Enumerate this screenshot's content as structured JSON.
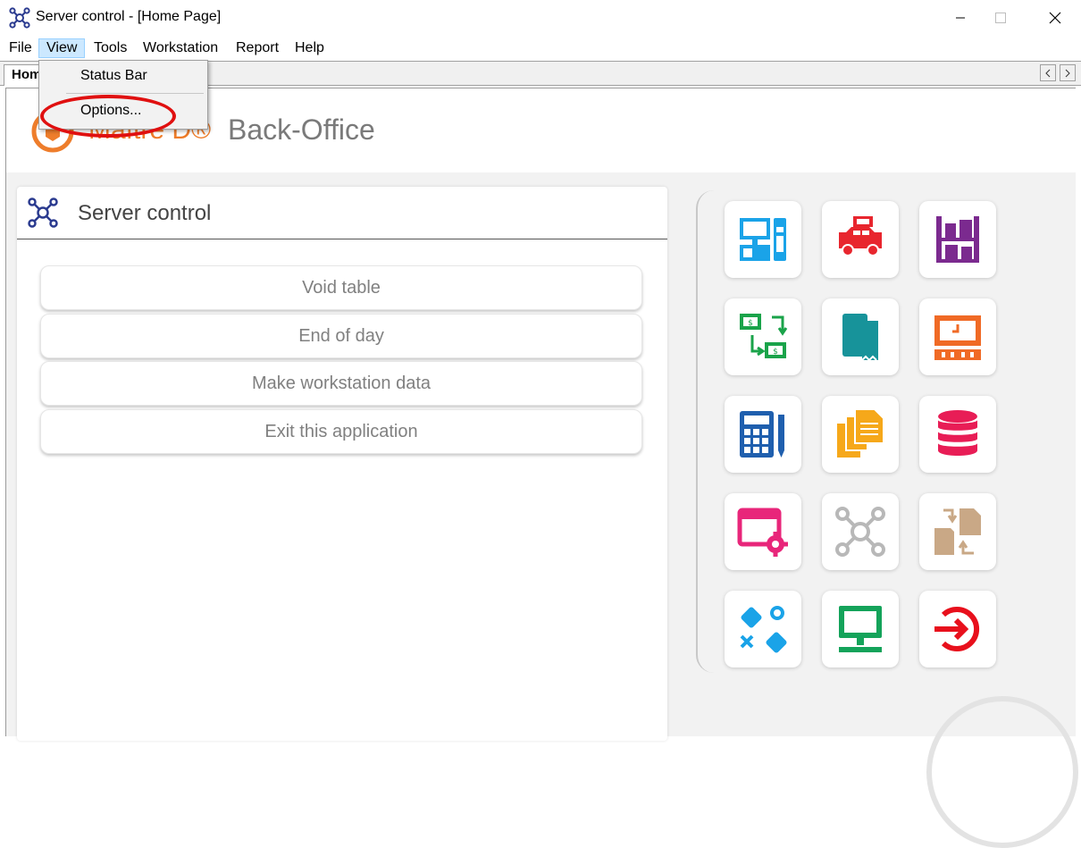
{
  "window": {
    "title": "Server control - [Home Page]"
  },
  "menubar": {
    "items": [
      "File",
      "View",
      "Tools",
      "Workstation",
      "Report",
      "Help"
    ],
    "active": "View"
  },
  "view_menu": {
    "items": [
      "Status Bar",
      "Options..."
    ],
    "highlighted": "Options..."
  },
  "tabs": {
    "home_label": "Hom"
  },
  "header": {
    "brand": "Maître D®",
    "product": "Back-Office"
  },
  "panel": {
    "title": "Server control",
    "buttons": [
      "Void table",
      "End of day",
      "Make workstation data",
      "Exit this application"
    ]
  },
  "tiles": [
    {
      "icon": "pos-terminal-icon",
      "color": "#1aa3e8"
    },
    {
      "icon": "delivery-car-icon",
      "color": "#e8262e"
    },
    {
      "icon": "inventory-shelf-icon",
      "color": "#7b2a8f"
    },
    {
      "icon": "money-transfer-icon",
      "color": "#1aa34a"
    },
    {
      "icon": "ledger-book-icon",
      "color": "#17939a"
    },
    {
      "icon": "time-clock-icon",
      "color": "#f06a25"
    },
    {
      "icon": "calculator-icon",
      "color": "#1f5fae"
    },
    {
      "icon": "documents-icon",
      "color": "#f6a81a"
    },
    {
      "icon": "database-icon",
      "color": "#e81d56"
    },
    {
      "icon": "window-settings-icon",
      "color": "#e8267a"
    },
    {
      "icon": "server-network-icon",
      "color": "#b8b8b8"
    },
    {
      "icon": "file-exchange-icon",
      "color": "#c9a886"
    },
    {
      "icon": "strategy-icon",
      "color": "#1aa3e8"
    },
    {
      "icon": "monitor-icon",
      "color": "#14a35a"
    },
    {
      "icon": "sign-in-icon",
      "color": "#e8101c"
    }
  ]
}
